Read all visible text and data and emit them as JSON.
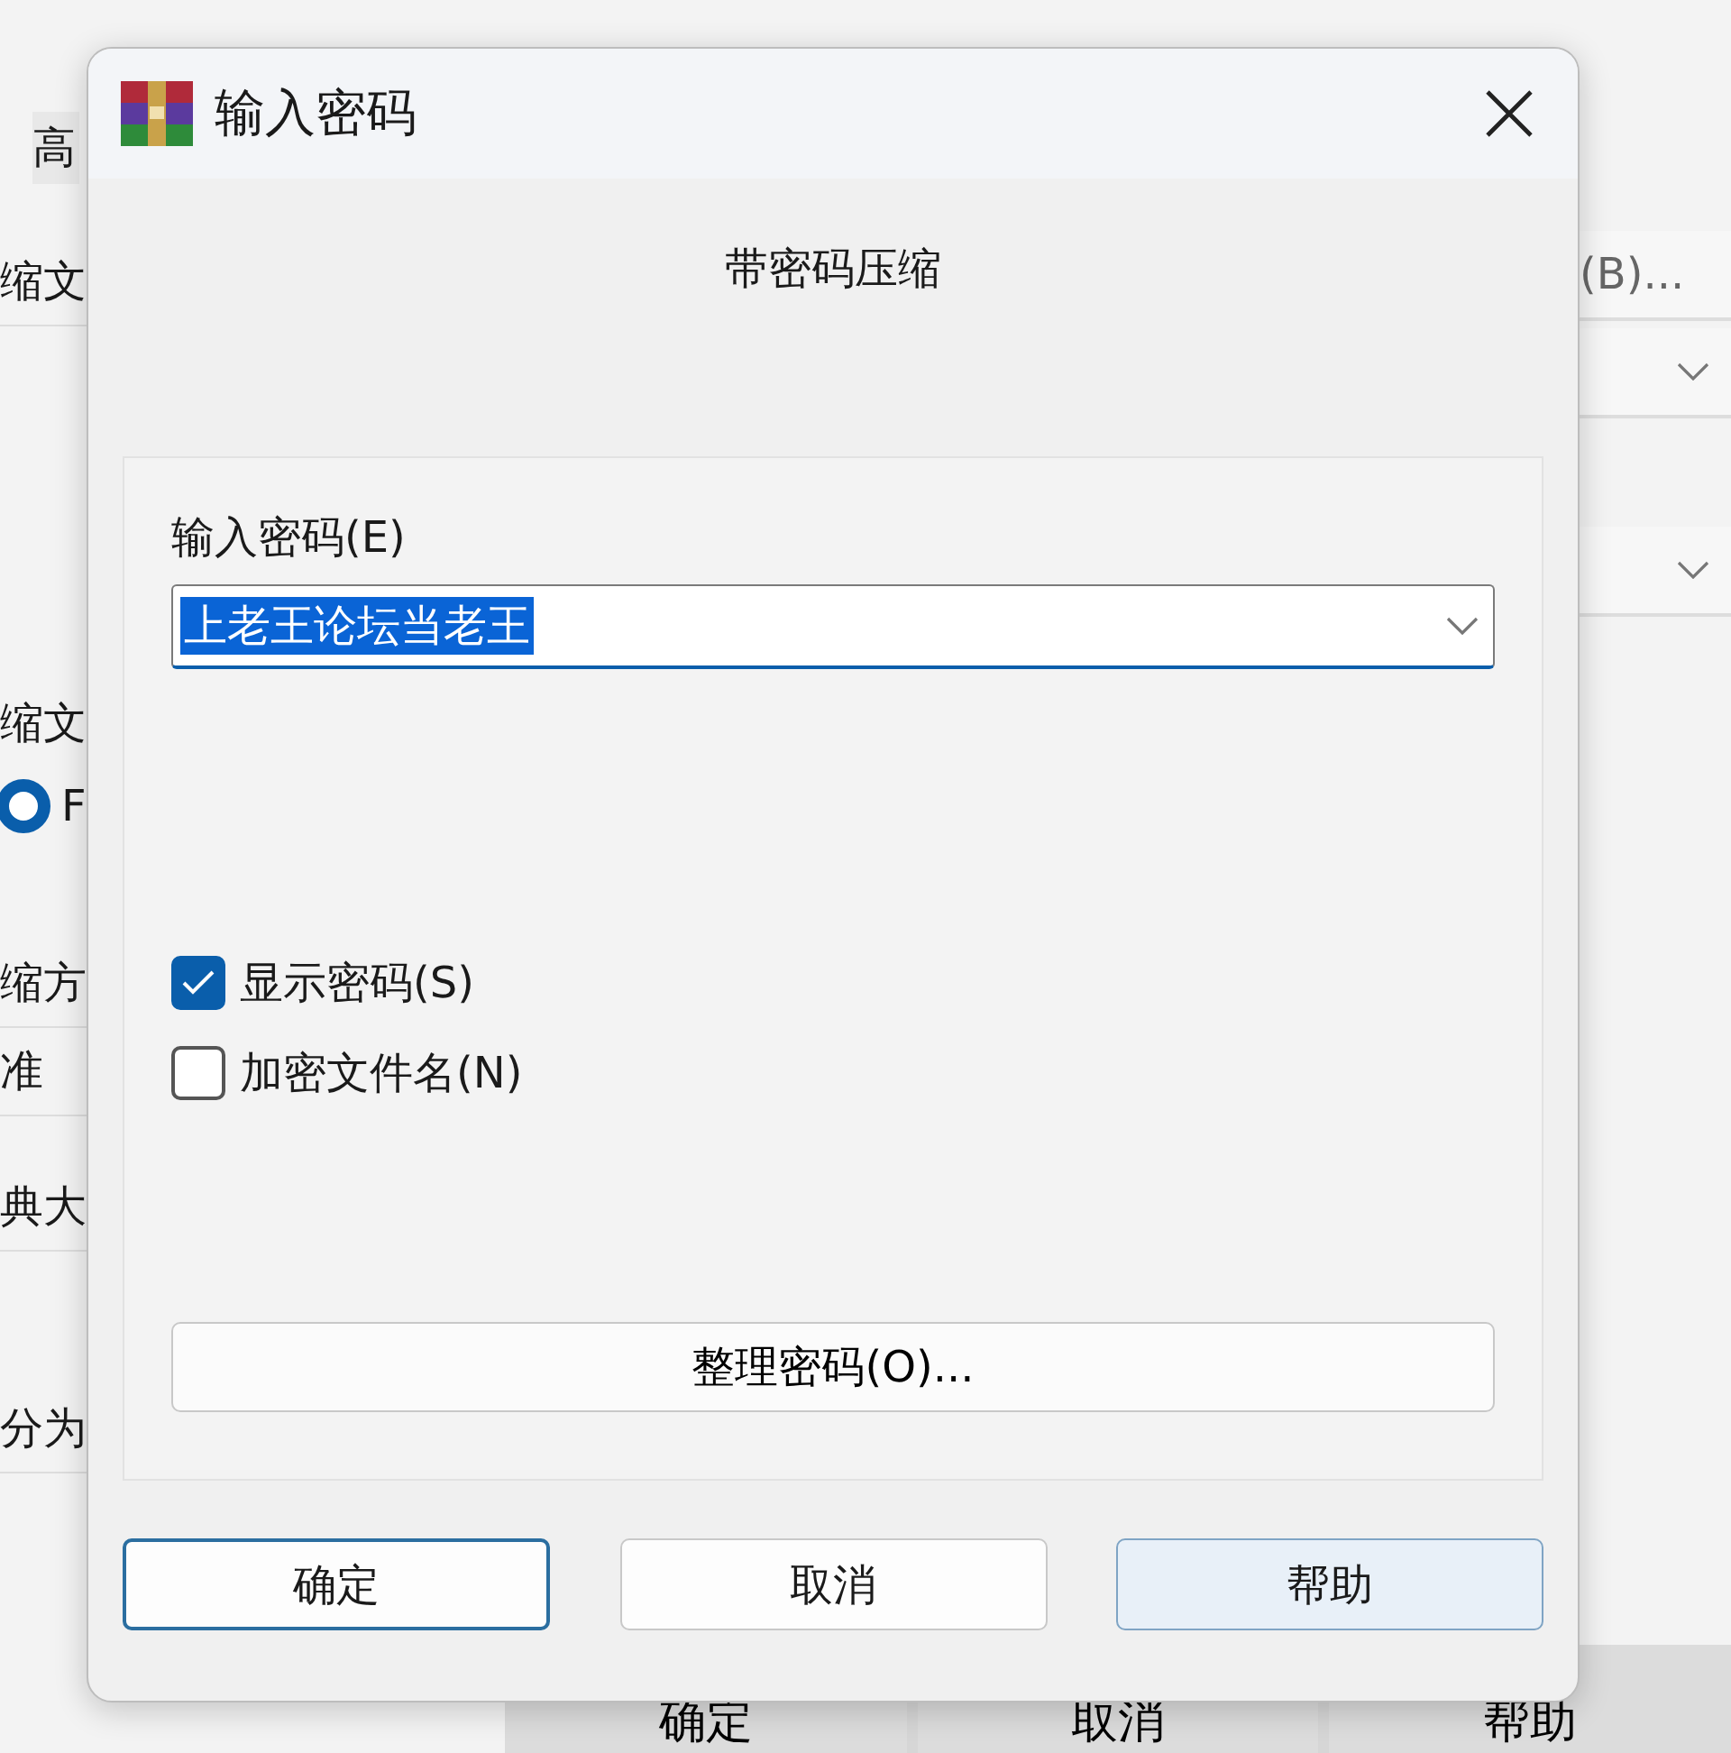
{
  "background_window": {
    "tab": "高",
    "left_labels": [
      "缩文",
      "缩文",
      "缩方",
      "准",
      "典大",
      "分为"
    ],
    "radio": {
      "label": "F",
      "selected": true
    },
    "browse_button": "(B)...",
    "buttons": [
      "确定",
      "取消",
      "帮助"
    ]
  },
  "dialog": {
    "title": "输入密码",
    "subtitle": "带密码压缩",
    "password": {
      "label": "输入密码(E)",
      "value": "上老王论坛当老王",
      "text_selected": true
    },
    "options": [
      {
        "label": "显示密码(S)",
        "checked": true
      },
      {
        "label": "加密文件名(N)",
        "checked": false
      }
    ],
    "organize_button": "整理密码(O)...",
    "buttons": [
      {
        "label": "确定",
        "default": true,
        "hovered": false
      },
      {
        "label": "取消",
        "default": false,
        "hovered": false
      },
      {
        "label": "帮助",
        "default": false,
        "hovered": true
      }
    ]
  }
}
